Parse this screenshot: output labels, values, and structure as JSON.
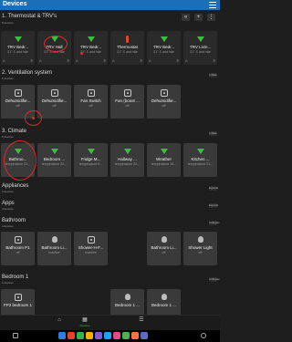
{
  "header": {
    "title": "Devices"
  },
  "toolbar": {
    "collapse_icon": "«",
    "add_icon": "+",
    "more_icon": "⋮"
  },
  "sections": [
    {
      "title": "1. Thermostat & TRV's",
      "sub": "8 devices",
      "tiles": [
        {
          "name": "TRV Bedr...",
          "state": "21° C and idle",
          "left": "⌂",
          "right": "≡"
        },
        {
          "name": "TRV Hall",
          "state": "21° C and idle",
          "left": "⌂",
          "right": "≡"
        },
        {
          "name": "TRV Bedr...",
          "state": "21° C and idle",
          "left": "⌂",
          "right": "≡"
        },
        {
          "name": "Thermostat",
          "state": "21° C and idle",
          "left": "⌂",
          "right": "≡"
        },
        {
          "name": "TRV Bedr...",
          "state": "21° C and idle",
          "left": "⌂",
          "right": "≡"
        },
        {
          "name": "TRV Livin...",
          "state": "21° C and idle",
          "left": "⌂",
          "right": "≡"
        }
      ]
    },
    {
      "title": "2. Ventilation system",
      "sub": "5 devices",
      "btn": "Inflate",
      "tiles": [
        {
          "name": "Dehumidifie...",
          "state": "off",
          "left": "",
          "right": ""
        },
        {
          "name": "Dehumidifie...",
          "state": "off",
          "left": "",
          "right": ""
        },
        {
          "name": "Fan Switch",
          "state": "off",
          "left": "",
          "right": ""
        },
        {
          "name": "Fan (boost ...",
          "state": "off",
          "left": "",
          "right": ""
        },
        {
          "name": "Dehumidifie...",
          "state": "off",
          "left": "",
          "right": ""
        }
      ]
    },
    {
      "title": "3. Climate",
      "sub": "6 devices",
      "btn": "Inflate",
      "tiles": [
        {
          "name": "Bathroo...",
          "state": "temperature 23..."
        },
        {
          "name": "Bedroom ...",
          "state": "temperature 22..."
        },
        {
          "name": "Fridge M...",
          "state": "temperature 6..."
        },
        {
          "name": "Hallway ...",
          "state": "temperature 22..."
        },
        {
          "name": "Weather",
          "state": "temperature 15..."
        },
        {
          "name": "Kitchen ...",
          "state": "temperature 21..."
        }
      ]
    },
    {
      "title": "Appliances",
      "sub": "3 devices",
      "btn": "Expand"
    },
    {
      "title": "Apps",
      "sub": "3 devices",
      "btn": "Expand"
    },
    {
      "title": "Bathroom",
      "sub": "4 devices",
      "btn": "Collapse",
      "tiles": [
        {
          "name": "Bathroom P1",
          "state": "off"
        },
        {
          "name": "Bathroom Li...",
          "state": "inactive"
        },
        {
          "name": "Shower-H-F...",
          "state": "inactive"
        },
        {
          "name": "Bathroom Li...",
          "state": "off"
        },
        {
          "name": "Shower Light",
          "state": "off"
        }
      ]
    },
    {
      "title": "Bedroom 1",
      "sub": "6 devices",
      "btn": "Collapse",
      "tiles": [
        {
          "name": "FP2 bedroom 1",
          "state": ""
        },
        {
          "name": "Bedroom 1 ...",
          "state": ""
        },
        {
          "name": "Bedroom 1 ...",
          "state": ""
        }
      ]
    }
  ],
  "bottom_nav": {
    "items": [
      {
        "icon": "⌂",
        "label": ""
      },
      {
        "icon": "▦",
        "label": "Devices"
      },
      {
        "icon": "☰",
        "label": ""
      }
    ]
  }
}
